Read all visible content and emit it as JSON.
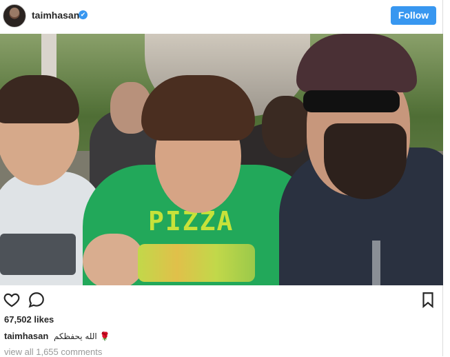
{
  "header": {
    "username": "taimhasan",
    "verified_symbol": "✔",
    "follow_label": "Follow",
    "follow_color": "#3897f0"
  },
  "photo": {
    "content": "selfie photo"
  },
  "photo_text": {
    "shirt_print": "PIZZA"
  },
  "actions": {
    "like_icon": "heart-icon",
    "comment_icon": "comment-icon",
    "save_icon": "bookmark-icon"
  },
  "likes": "67,502 likes",
  "caption": {
    "username": "taimhasan",
    "text": "🌹 الله يحفظكم"
  },
  "comments_link": "view all 1,655 comments"
}
